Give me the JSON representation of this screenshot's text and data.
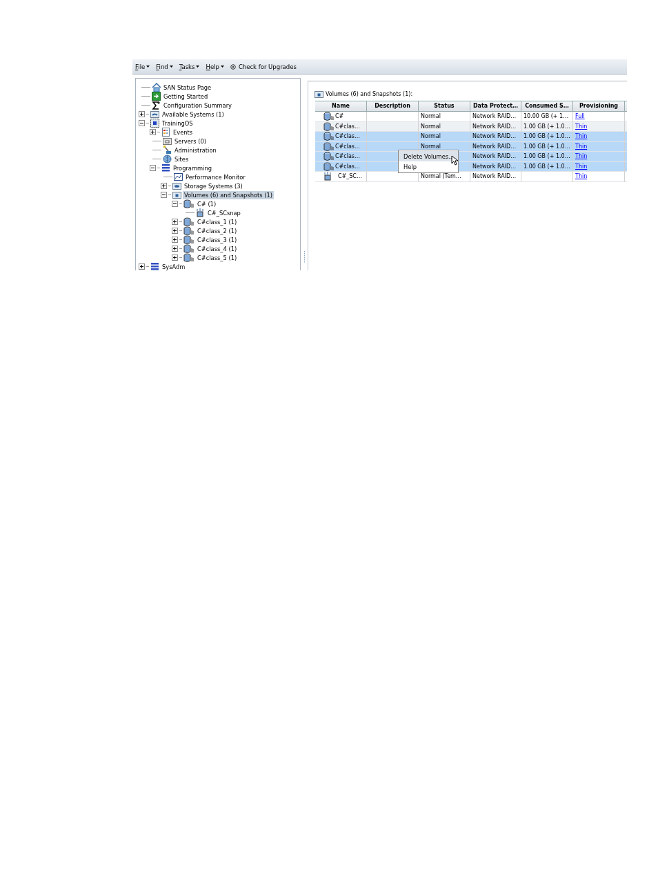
{
  "menu_bar": {
    "menus": [
      {
        "label": "File"
      },
      {
        "label": "Find"
      },
      {
        "label": "Tasks"
      },
      {
        "label": "Help"
      }
    ],
    "upgrade_button": "Check for Upgrades"
  },
  "tree": [
    {
      "label": "SAN Status Page",
      "kind": "home",
      "selected": false
    },
    {
      "label": "Getting Started",
      "kind": "start",
      "selected": false
    },
    {
      "label": "Configuration Summary",
      "kind": "sum",
      "selected": false
    },
    {
      "label": "Available Systems (1)",
      "kind": "systems",
      "selected": false,
      "expanded": false
    },
    {
      "label": "TrainingOS",
      "kind": "cluster",
      "selected": false,
      "expanded": true,
      "children": [
        {
          "label": "Events",
          "kind": "events",
          "selected": false,
          "expanded": false
        },
        {
          "label": "Servers (0)",
          "kind": "servers",
          "selected": false
        },
        {
          "label": "Administration",
          "kind": "admin",
          "selected": false
        },
        {
          "label": "Sites",
          "kind": "sites",
          "selected": false
        },
        {
          "label": "Programming",
          "kind": "group",
          "selected": false,
          "expanded": true,
          "children": [
            {
              "label": "Performance Monitor",
              "kind": "monitor",
              "selected": false
            },
            {
              "label": "Storage Systems (3)",
              "kind": "storage",
              "selected": false,
              "expanded": false
            },
            {
              "label": "Volumes (6) and Snapshots (1)",
              "kind": "volumes",
              "selected": true,
              "expanded": true,
              "children": [
                {
                  "label": "C# (1)",
                  "kind": "volume",
                  "selected": false,
                  "expanded": true,
                  "children": [
                    {
                      "label": "C#_SCsnap",
                      "kind": "snapshot",
                      "selected": false
                    }
                  ]
                },
                {
                  "label": "C#class_1 (1)",
                  "kind": "volume",
                  "selected": false,
                  "expanded": false
                },
                {
                  "label": "C#class_2 (1)",
                  "kind": "volume",
                  "selected": false,
                  "expanded": false
                },
                {
                  "label": "C#class_3 (1)",
                  "kind": "volume",
                  "selected": false,
                  "expanded": false
                },
                {
                  "label": "C#class_4 (1)",
                  "kind": "volume",
                  "selected": false,
                  "expanded": false
                },
                {
                  "label": "C#class_5 (1)",
                  "kind": "volume",
                  "selected": false,
                  "expanded": false
                }
              ]
            }
          ]
        }
      ]
    },
    {
      "label": "SysAdm",
      "kind": "group",
      "selected": false,
      "expanded": false
    }
  ],
  "panel_title": "Volumes (6) and Snapshots (1):",
  "table": {
    "columns": [
      "Name",
      "Description",
      "Status",
      "Data Protect…",
      "Consumed S…",
      "Provisioning"
    ],
    "rows": [
      {
        "kind": "volume",
        "selected": false,
        "name": "C#",
        "description": "",
        "status": "Normal",
        "data_protection": "Network RAID…",
        "consumed": "10.00 GB (+ 1…",
        "provisioning": "Full"
      },
      {
        "kind": "volume",
        "selected": false,
        "name": "C#clas…",
        "status": "Normal",
        "data_protection": "Network RAID…",
        "consumed": "1.00 GB (+ 1.0…",
        "provisioning": "Thin"
      },
      {
        "kind": "volume",
        "selected": true,
        "name": "C#clas…",
        "status": "Normal",
        "data_protection": "Network RAID…",
        "consumed": "1.00 GB (+ 1.0…",
        "provisioning": "Thin"
      },
      {
        "kind": "volume",
        "selected": true,
        "name": "C#clas…",
        "status": "Normal",
        "data_protection": "Network RAID…",
        "consumed": "1.00 GB (+ 1.0…",
        "provisioning": "Thin"
      },
      {
        "kind": "volume",
        "selected": true,
        "name": "C#clas…",
        "data_protection": "Network RAID…",
        "consumed": "1.00 GB (+ 1.0…",
        "provisioning": "Thin"
      },
      {
        "kind": "volume",
        "selected": true,
        "name": "C#clas…",
        "data_protection": "Network RAID…",
        "consumed": "1.00 GB (+ 1.0…",
        "provisioning": "Thin"
      },
      {
        "kind": "snapshot",
        "selected": false,
        "name": "C#_SC…",
        "status": "Normal (Tem…",
        "data_protection": "Network RAID…",
        "provisioning": "Thin"
      }
    ]
  },
  "context_menu": {
    "items": [
      {
        "label": "Delete Volumes...",
        "selected": true
      },
      {
        "label": "Help",
        "selected": false
      }
    ]
  }
}
